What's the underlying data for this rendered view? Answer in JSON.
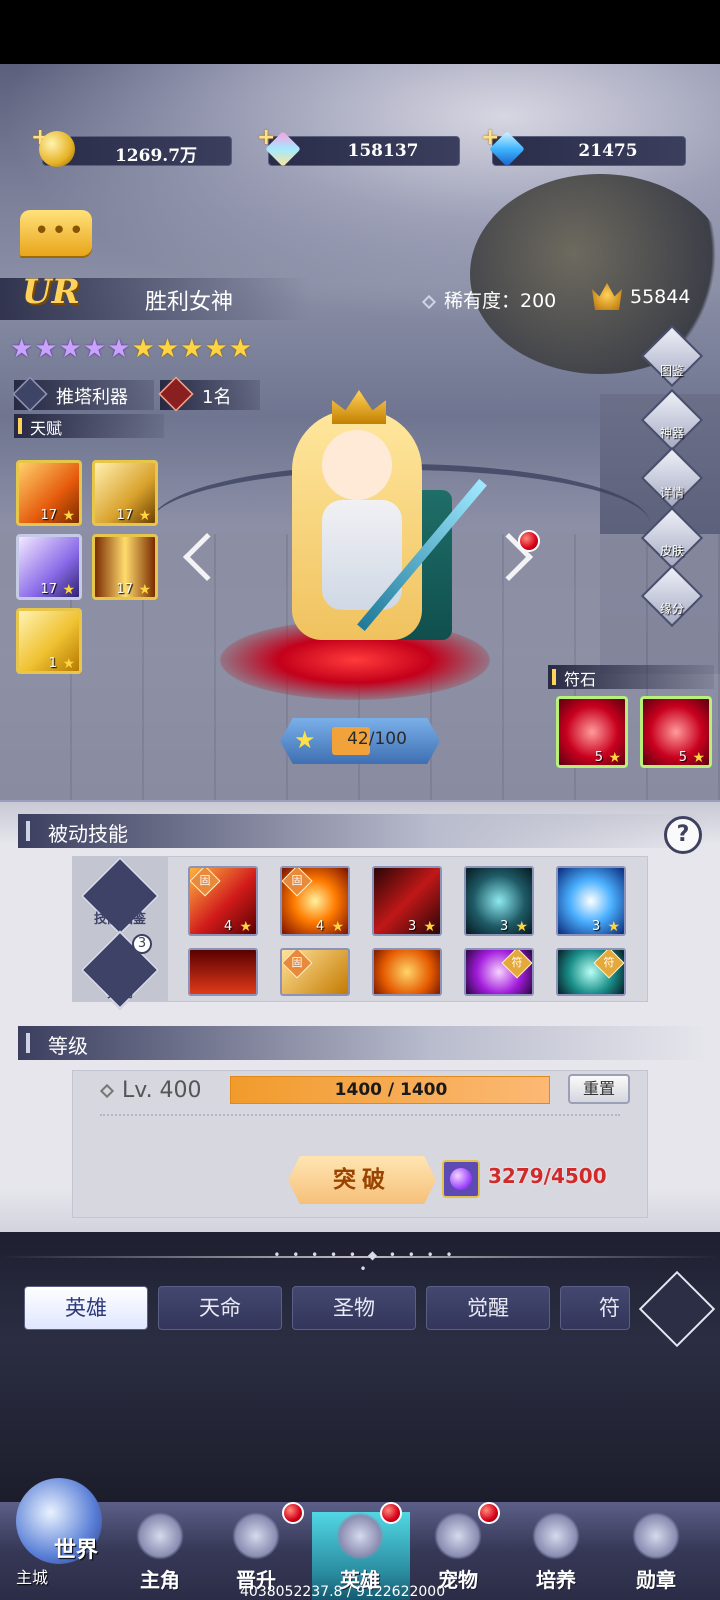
{
  "resources": [
    {
      "name": "gold",
      "icon": "gold-coin-icon",
      "value": "1269.7万"
    },
    {
      "name": "rainbow-gem",
      "icon": "rainbow-diamond-icon",
      "value": "158137"
    },
    {
      "name": "blue-gem",
      "icon": "blue-diamond-icon",
      "value": "21475"
    }
  ],
  "hero": {
    "grade": "UR",
    "name": "胜利女神",
    "rarity": "稀有度：200",
    "power": "55844",
    "stars_purple": "★★★★★",
    "stars_gold": "★★★★★",
    "tags": [
      {
        "label": "推塔利器",
        "icon": "crossed-swords-icon"
      },
      {
        "label": "1名",
        "icon": "flame-icon"
      }
    ],
    "exp_text": "42/100",
    "exp_fraction": 0.42
  },
  "talent": {
    "title": "天赋",
    "items": [
      {
        "level": "17",
        "icon": "fire-slash-talent-icon"
      },
      {
        "level": "17",
        "icon": "golden-wave-talent-icon"
      },
      {
        "level": "17",
        "icon": "purple-wind-talent-icon"
      },
      {
        "level": "17",
        "icon": "light-pillar-talent-icon"
      },
      {
        "level": "1",
        "icon": "blue-staff-talent-icon"
      }
    ]
  },
  "side_menu": [
    {
      "label": "图鉴",
      "icon": "codex-icon"
    },
    {
      "label": "神器",
      "icon": "artifact-icon"
    },
    {
      "label": "详情",
      "icon": "magnifier-icon"
    },
    {
      "label": "皮肤",
      "icon": "skin-icon"
    },
    {
      "label": "缘分",
      "icon": "heart-icon"
    }
  ],
  "runes": {
    "title": "符石",
    "items": [
      {
        "level": "5"
      },
      {
        "level": "5"
      }
    ]
  },
  "passive": {
    "title": "被动技能",
    "left_buttons": [
      {
        "label": "技能图鉴",
        "icon": "skill-codex-icon"
      },
      {
        "label": "共鸣",
        "icon": "resonance-icon",
        "badge": "3"
      }
    ],
    "row1": [
      {
        "level": "4",
        "badge": "固",
        "icon": "red-sword-skill-icon"
      },
      {
        "level": "4",
        "badge": "固",
        "icon": "fire-burst-skill-icon"
      },
      {
        "level": "3",
        "badge": "",
        "icon": "red-claw-skill-icon"
      },
      {
        "level": "3",
        "badge": "",
        "icon": "dark-bat-skill-icon"
      },
      {
        "level": "3",
        "badge": "",
        "icon": "blue-phoenix-skill-icon"
      }
    ],
    "row2": [
      {
        "badge": "",
        "icon": "demon-skill-icon"
      },
      {
        "badge": "固",
        "icon": "golden-shield-skill-icon"
      },
      {
        "badge": "",
        "icon": "fire-beast-skill-icon"
      },
      {
        "badge": "符",
        "icon": "purple-orb-skill-icon"
      },
      {
        "badge": "符",
        "icon": "teal-ghost-skill-icon"
      }
    ]
  },
  "level": {
    "title": "等级",
    "lv": "Lv. 400",
    "bar_text": "1400 / 1400",
    "bar_fraction": 1.0,
    "reset_label": "重置",
    "break_label": "突破",
    "orb_text": "3279/4500"
  },
  "tabs": [
    "英雄",
    "天命",
    "圣物",
    "觉醒",
    "符文"
  ],
  "tab_active": 0,
  "decor_dots": "• • • • • ◆ • • • • •",
  "nav": {
    "world": {
      "label": "世界",
      "sub": "主城"
    },
    "items": [
      {
        "label": "主角",
        "icon": "protagonist-icon",
        "dot": false
      },
      {
        "label": "晋升",
        "icon": "promotion-icon",
        "dot": true
      },
      {
        "label": "英雄",
        "icon": "hero-helmet-icon",
        "dot": true
      },
      {
        "label": "宠物",
        "icon": "pet-icon",
        "dot": true
      },
      {
        "label": "培养",
        "icon": "training-icon",
        "dot": false
      },
      {
        "label": "勋章",
        "icon": "medal-icon",
        "dot": false
      }
    ]
  },
  "footer_text": "4038052237.8 / 9122622000",
  "colors": {
    "accent_gold": "#ffd25a",
    "red_dot": "#d6001a",
    "active_tab": "#2a8b9f",
    "orb_text": "#d12a2a"
  }
}
